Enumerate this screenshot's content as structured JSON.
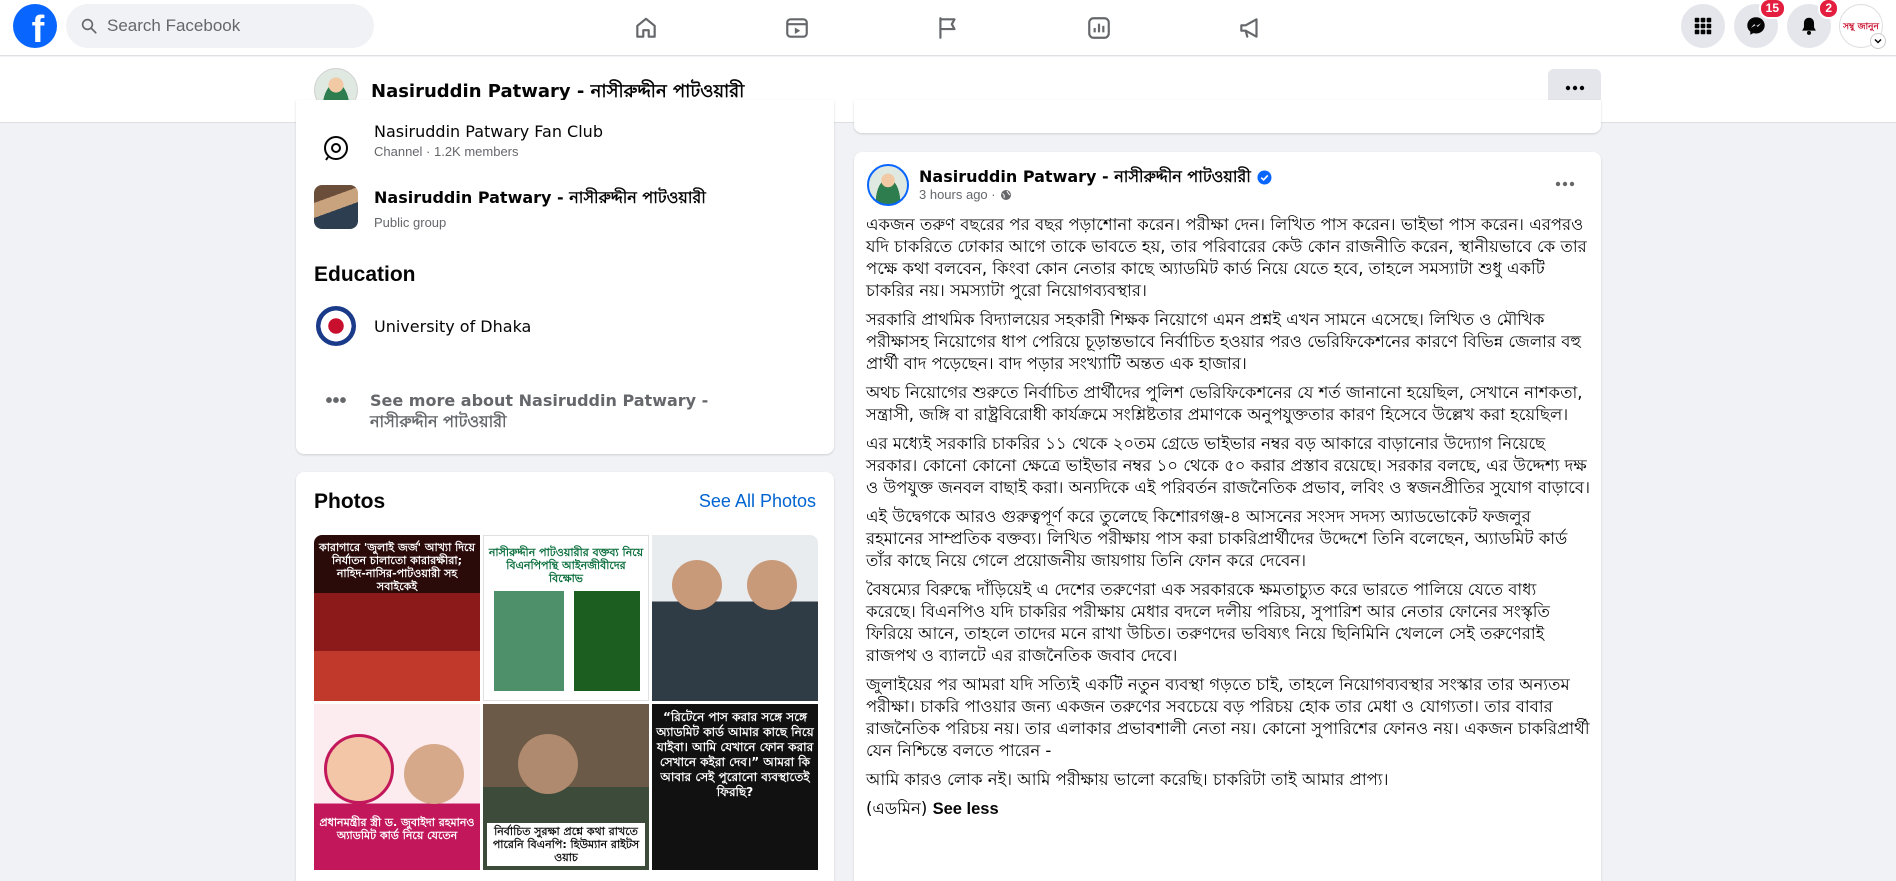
{
  "topnav": {
    "logo": "f",
    "search_placeholder": "Search Facebook",
    "icons": [
      "home-icon",
      "video-icon",
      "flag-icon",
      "dashboard-icon",
      "megaphone-icon"
    ],
    "messenger_badge": "15",
    "notifications_badge": "2",
    "profile_mini_text": "সম্বু জানুন"
  },
  "pagebar": {
    "title": "Nasiruddin Patwary - নাসীরুদ্দীন পাটওয়ারী"
  },
  "intro": {
    "channel": {
      "name": "Nasiruddin Patwary Fan Club",
      "meta": "Channel · 1.2K members"
    },
    "group": {
      "name": "Nasiruddin Patwary - নাসীরুদ্দীন পাটওয়ারী",
      "meta": "Public group"
    },
    "education_heading": "Education",
    "education": {
      "name": "University of Dhaka"
    },
    "see_more": "See more about Nasiruddin Patwary - নাসীরুদ্দীন পাটওয়ারী"
  },
  "photos": {
    "title": "Photos",
    "see_all": "See All Photos",
    "captions": [
      "কারাগারে 'জুলাই জর্জ' আখ্যা দিয়ে নির্যাতন চালাতো কারারক্ষীরা; নাহিদ-নাসির-পাটওয়ারী সহ সবাইকেই",
      "নাসীরুদ্দীন পাটওয়ারীর বক্তব্য নিয়ে বিএনপিপন্থি আইনজীবীদের বিক্ষোভ",
      "",
      "প্রধানমন্ত্রীর স্ত্রী ড. জুবাইদা রহমানও অ্যাডমিট কার্ড নিয়ে যেতেন",
      "নির্বাচিত সুরক্ষা প্রশ্নে কথা রাখতে পারেনি বিএনপি: হিউম্যান রাইটস ওয়াচ",
      "“রিটেনে পাস করার সঙ্গে সঙ্গে অ্যাডমিট কার্ড আমার কাছে নিয়ে যাইবা। আমি যেখানে ফোন করার সেখানে কইরা দেব।” আমরা কি আবার সেই পুরোনো ব্যবস্থাতেই ফিরছি?"
    ]
  },
  "post": {
    "author": "Nasiruddin Patwary - নাসীরুদ্দীন পাটওয়ারী",
    "time": "3 hours ago ·",
    "paragraphs": [
      "একজন তরুণ বছরের পর বছর পড়াশোনা করেন। পরীক্ষা দেন। লিখিত পাস করেন। ভাইভা পাস করেন। এরপরও যদি চাকরিতে ঢোকার আগে তাকে ভাবতে হয়, তার পরিবারের কেউ কোন রাজনীতি করেন, স্থানীয়ভাবে কে তার পক্ষে কথা বলবেন, কিংবা কোন নেতার কাছে অ্যাডমিট কার্ড নিয়ে যেতে হবে, তাহলে সমস্যাটা শুধু একটি চাকরির নয়। সমস্যাটা পুরো নিয়োগব্যবস্থার।",
      "সরকারি প্রাথমিক বিদ্যালয়ের সহকারী শিক্ষক নিয়োগে এমন প্রশ্নই এখন সামনে এসেছে। লিখিত ও মৌখিক পরীক্ষাসহ নিয়োগের ধাপ পেরিয়ে চূড়ান্তভাবে নির্বাচিত হওয়ার পরও ভেরিফিকেশনের কারণে বিভিন্ন জেলার বহু প্রার্থী বাদ পড়েছেন। বাদ পড়ার সংখ্যাটি অন্তত এক হাজার।",
      "অথচ নিয়োগের শুরুতে নির্বাচিত প্রার্থীদের পুলিশ ভেরিফিকেশনের যে শর্ত জানানো হয়েছিল, সেখানে নাশকতা, সন্ত্রাসী, জঙ্গি বা রাষ্ট্রবিরোধী কার্যক্রমে সংশ্লিষ্টতার প্রমাণকে অনুপযুক্ততার কারণ হিসেবে উল্লেখ করা হয়েছিল।",
      "এর মধ্যেই সরকারি চাকরির ১১ থেকে ২০তম গ্রেডে ভাইভার নম্বর বড় আকারে বাড়ানোর উদ্যোগ নিয়েছে সরকার। কোনো কোনো ক্ষেত্রে ভাইভার নম্বর ১০ থেকে ৫০ করার প্রস্তাব রয়েছে। সরকার বলছে, এর উদ্দেশ্য দক্ষ ও উপযুক্ত জনবল বাছাই করা। অন্যদিকে এই পরিবর্তন রাজনৈতিক প্রভাব, লবিং ও স্বজনপ্রীতির সুযোগ বাড়াবে।",
      "এই উদ্বেগকে আরও গুরুত্বপূর্ণ করে তুলেছে কিশোরগঞ্জ-৪ আসনের সংসদ সদস্য অ্যাডভোকেট ফজলুর রহমানের সাম্প্রতিক বক্তব্য। লিখিত পরীক্ষায় পাস করা চাকরিপ্রার্থীদের উদ্দেশে তিনি বলেছেন, অ্যাডমিট কার্ড তাঁর কাছে নিয়ে গেলে প্রয়োজনীয় জায়গায় তিনি ফোন করে দেবেন।",
      "বৈষম্যের বিরুদ্ধে দাঁড়িয়েই এ দেশের তরুণেরা এক সরকারকে ক্ষমতাচ্যুত করে ভারতে পালিয়ে যেতে বাধ্য করেছে। বিএনপিও যদি চাকরির পরীক্ষায় মেধার বদলে দলীয় পরিচয়, সুপারিশ আর নেতার ফোনের সংস্কৃতি ফিরিয়ে আনে, তাহলে তাদের মনে রাখা উচিত। তরুণদের ভবিষ্যৎ নিয়ে ছিনিমিনি খেললে সেই তরুণেরাই রাজপথ ও ব্যালটে এর রাজনৈতিক জবাব দেবে।",
      "জুলাইয়ের পর আমরা যদি সত্যিই একটি নতুন ব্যবস্থা গড়তে চাই, তাহলে নিয়োগব্যবস্থার সংস্কার তার অন্যতম পরীক্ষা। চাকরি পাওয়ার জন্য একজন তরুণের সবচেয়ে বড় পরিচয় হোক তার মেধা ও যোগ্যতা। তার বাবার রাজনৈতিক পরিচয় নয়। তার এলাকার প্রভাবশালী নেতা নয়। কোনো সুপারিশের ফোনও নয়। একজন চাকরিপ্রার্থী যেন নিশ্চিন্তে বলতে পারেন -",
      "আমি কারও লোক নই। আমি পরীক্ষায় ভালো করেছি। চাকরিটা তাই আমার প্রাপ্য।"
    ],
    "signoff": "(এডমিন)",
    "see_less": "See less"
  }
}
